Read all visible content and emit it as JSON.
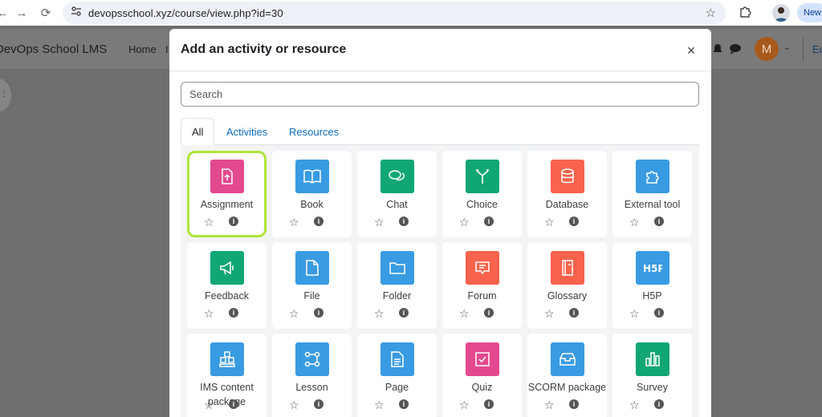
{
  "browser": {
    "back": "←",
    "forward": "→",
    "reload": "⟳",
    "url": "devopsschool.xyz/course/view.php?id=30",
    "new_label": "New"
  },
  "moodle_nav": {
    "site_name": "DevOps School LMS",
    "home": "Home",
    "truncated_item": "I",
    "avatar_letter": "M",
    "edit_mode_fragment": "Ec"
  },
  "modal": {
    "title": "Add an activity or resource",
    "close": "×",
    "search_placeholder": "Search",
    "tabs": [
      "All",
      "Activities",
      "Resources"
    ],
    "items": [
      {
        "label": "Assignment",
        "color": "#e3498f",
        "icon": "assignment-icon",
        "highlight": true
      },
      {
        "label": "Book",
        "color": "#399be2",
        "icon": "book-icon"
      },
      {
        "label": "Chat",
        "color": "#11a676",
        "icon": "chat-icon"
      },
      {
        "label": "Choice",
        "color": "#11a676",
        "icon": "choice-icon"
      },
      {
        "label": "Database",
        "color": "#f7634d",
        "icon": "database-icon"
      },
      {
        "label": "External tool",
        "color": "#399be2",
        "icon": "external-tool-icon"
      },
      {
        "label": "Feedback",
        "color": "#11a676",
        "icon": "feedback-icon"
      },
      {
        "label": "File",
        "color": "#399be2",
        "icon": "file-icon"
      },
      {
        "label": "Folder",
        "color": "#399be2",
        "icon": "folder-icon"
      },
      {
        "label": "Forum",
        "color": "#f7634d",
        "icon": "forum-icon"
      },
      {
        "label": "Glossary",
        "color": "#f7634d",
        "icon": "glossary-icon"
      },
      {
        "label": "H5P",
        "color": "#399be2",
        "icon": "h5p-icon"
      },
      {
        "label": "IMS content package",
        "color": "#399be2",
        "icon": "ims-package-icon"
      },
      {
        "label": "Lesson",
        "color": "#399be2",
        "icon": "lesson-icon"
      },
      {
        "label": "Page",
        "color": "#399be2",
        "icon": "page-icon"
      },
      {
        "label": "Quiz",
        "color": "#e3498f",
        "icon": "quiz-icon"
      },
      {
        "label": "SCORM package",
        "color": "#399be2",
        "icon": "scorm-icon"
      },
      {
        "label": "Survey",
        "color": "#11a676",
        "icon": "survey-icon"
      }
    ],
    "star_glyph": "☆",
    "info_glyph": "i"
  }
}
